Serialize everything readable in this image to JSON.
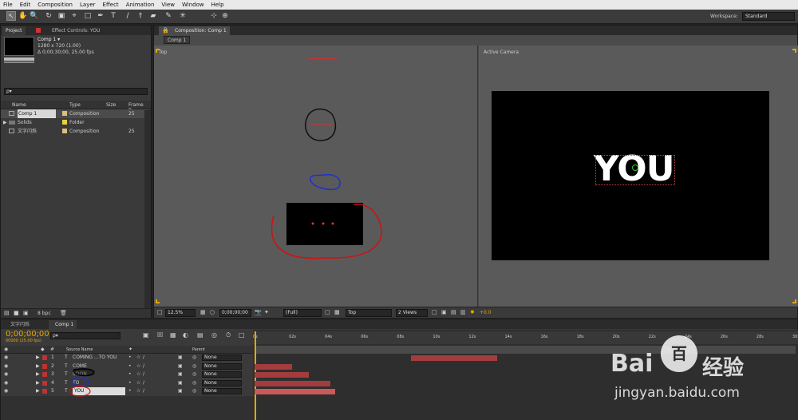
{
  "menu": [
    "File",
    "Edit",
    "Composition",
    "Layer",
    "Effect",
    "Animation",
    "View",
    "Window",
    "Help"
  ],
  "workspace": {
    "label": "Workspace:",
    "value": "Standard"
  },
  "project": {
    "tab_project": "Project",
    "tab_effects": "Effect Controls: YOU",
    "comp_name": "Comp 1 ▾",
    "comp_size": "1280 x 720 (1.00)",
    "comp_dur": "Δ 0;00;30;00, 25.00 fps",
    "search_placeholder": "ρ▾",
    "col_name": "Name",
    "col_type": "Type",
    "col_size": "Size",
    "col_fr": "Frame R...",
    "items": [
      {
        "name": "Comp 1",
        "type": "Composition",
        "fr": "25",
        "color": "#d8c080"
      },
      {
        "name": "Solids",
        "type": "Folder",
        "fr": "",
        "color": "#e8d040"
      },
      {
        "name": "文字闪烁",
        "type": "Composition",
        "fr": "25",
        "color": "#d8c080"
      }
    ],
    "bpc": "8 bpc"
  },
  "comp": {
    "tab": "Composition: Comp 1",
    "sub_tab": "Comp 1",
    "view_left_label": "Top",
    "view_right_label": "Active Camera",
    "zoom": "12.5%",
    "timecode": "0;00;00;00",
    "quality": "(Full)",
    "view": "Top",
    "views": "2 Views",
    "exposure": "+0.0",
    "text_you": "YOU"
  },
  "timeline": {
    "tab_a": "文字闪烁",
    "tab_b": "Comp 1",
    "timecode": "0;00;00;00",
    "fps": "00000 (25.00 fps)",
    "col_source": "Source Name",
    "col_parent": "Parent",
    "ticks": [
      "0s",
      "02s",
      "04s",
      "06s",
      "08s",
      "10s",
      "12s",
      "14s",
      "16s",
      "18s",
      "20s",
      "22s",
      "24s",
      "26s",
      "28s",
      "30s"
    ],
    "layers": [
      {
        "num": "1",
        "name": "COMING ...TO YOU",
        "parent": "None",
        "bar_start": 0.29,
        "bar_end": 0.45
      },
      {
        "num": "2",
        "name": "COME",
        "parent": "None",
        "bar_start": 0.0,
        "bar_end": 0.07
      },
      {
        "num": "3",
        "name": "SOON",
        "parent": "None",
        "bar_start": 0.0,
        "bar_end": 0.1
      },
      {
        "num": "4",
        "name": "TO",
        "parent": "None",
        "bar_start": 0.0,
        "bar_end": 0.14
      },
      {
        "num": "5",
        "name": "YOU",
        "parent": "None",
        "bar_start": 0.0,
        "bar_end": 0.15
      }
    ]
  },
  "watermark": {
    "brand": "Bai",
    "brand2": "百",
    "brand_cn": "经验",
    "url": "jingyan.baidu.com"
  }
}
